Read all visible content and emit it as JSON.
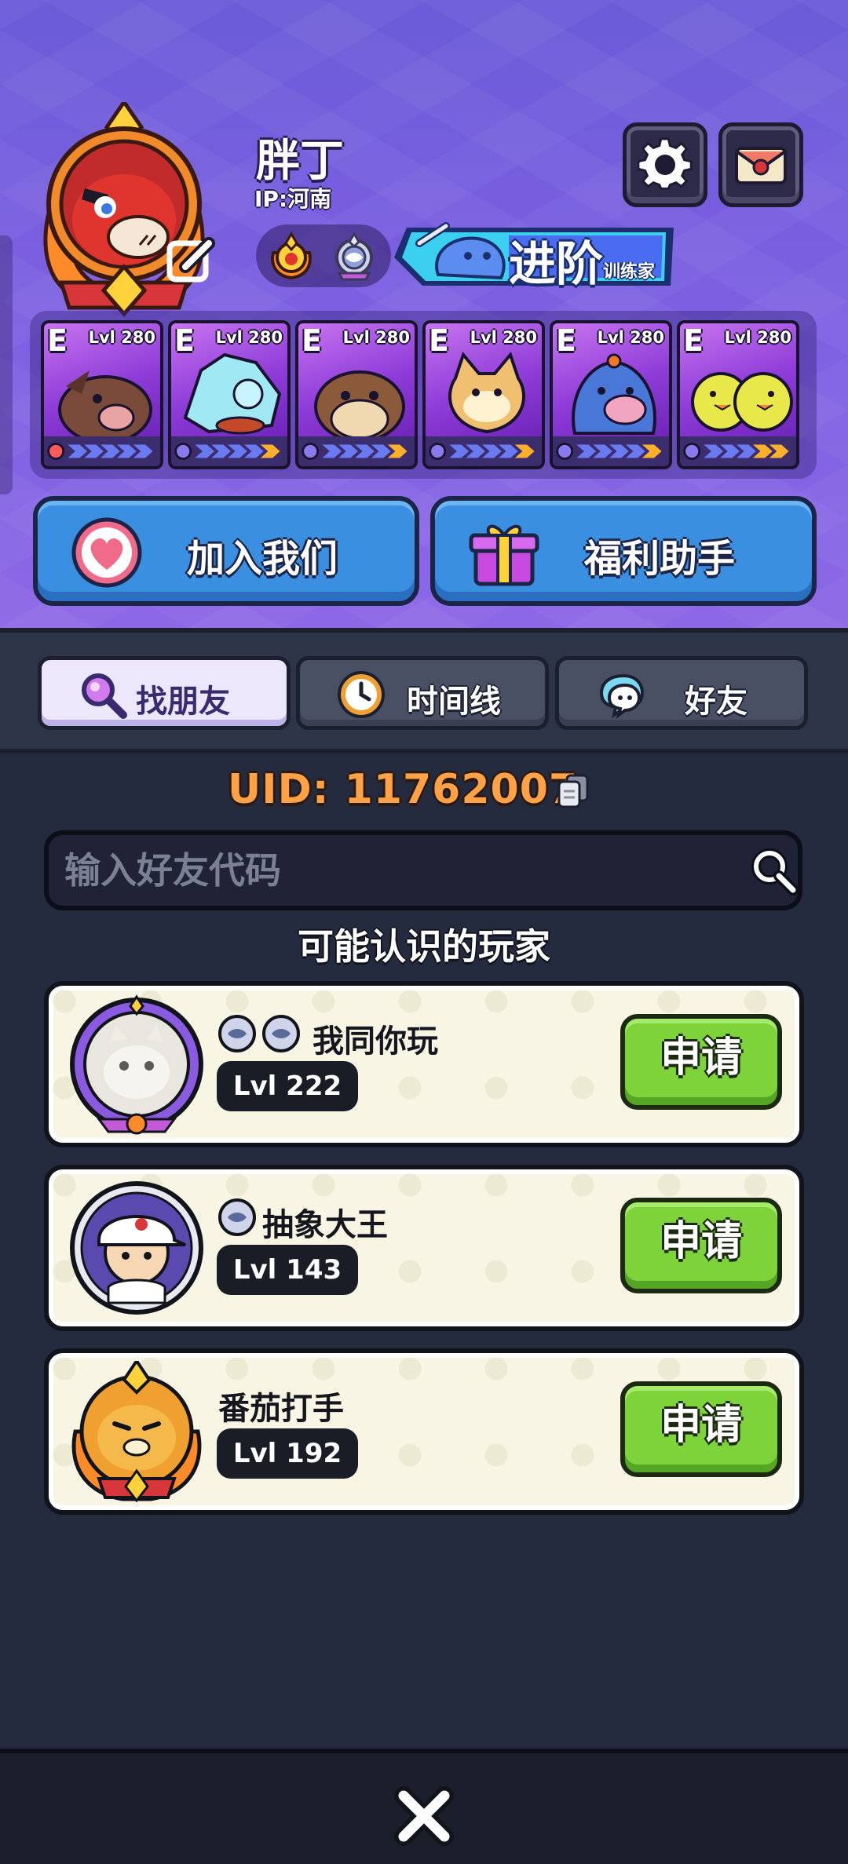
{
  "profile": {
    "name": "胖丁",
    "ip": "IP:河南",
    "advance_label": "进阶",
    "advance_sub": "训练家"
  },
  "cards": [
    {
      "grade": "E",
      "level": "Lvl 280",
      "creature": "boar"
    },
    {
      "grade": "E",
      "level": "Lvl 280",
      "creature": "crystal-shell"
    },
    {
      "grade": "E",
      "level": "Lvl 280",
      "creature": "otter"
    },
    {
      "grade": "E",
      "level": "Lvl 280",
      "creature": "fox-cat"
    },
    {
      "grade": "E",
      "level": "Lvl 280",
      "creature": "blue-walrus"
    },
    {
      "grade": "E",
      "level": "Lvl 280",
      "creature": "yellow-chicks"
    }
  ],
  "actions": {
    "join_label": "加入我们",
    "welfare_label": "福利助手"
  },
  "tabs": [
    {
      "label": "找朋友",
      "icon": "magnifier-icon",
      "active": true
    },
    {
      "label": "时间线",
      "icon": "clock-icon",
      "active": false
    },
    {
      "label": "好友",
      "icon": "chat-bubble-icon",
      "active": false
    }
  ],
  "uid": {
    "label": "UID:  11762007"
  },
  "search": {
    "placeholder": "输入好友代码",
    "value": ""
  },
  "suggested": {
    "title": "可能认识的玩家",
    "players": [
      {
        "name": "我同你玩",
        "level": "Lvl 222",
        "apply_label": "申请"
      },
      {
        "name": "抽象大王",
        "level": "Lvl 143",
        "apply_label": "申请"
      },
      {
        "name": "番茄打手",
        "level": "Lvl 192",
        "apply_label": "申请"
      }
    ]
  },
  "colors": {
    "uid": "#ffa146",
    "apply_green": "#7ed23a",
    "action_blue": "#3a8fe0",
    "header_purple": "#7a5fe0"
  }
}
